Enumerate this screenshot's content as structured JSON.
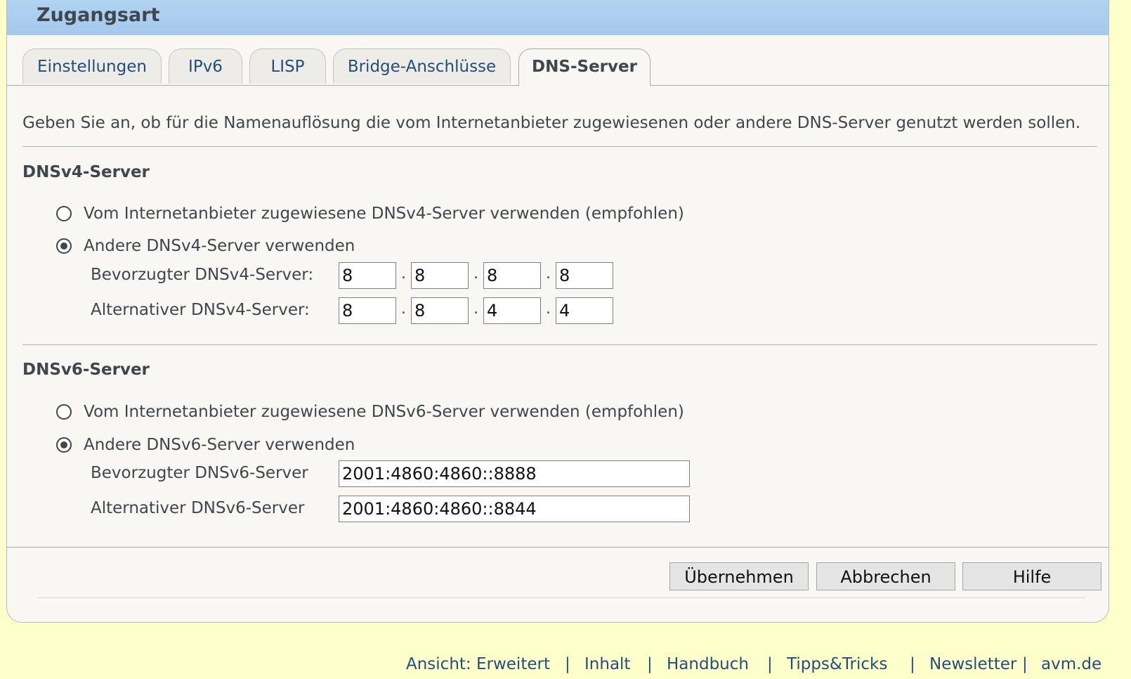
{
  "window": {
    "title": "Zugangsart"
  },
  "tabs": [
    {
      "label": "Einstellungen",
      "active": false
    },
    {
      "label": "IPv6",
      "active": false
    },
    {
      "label": "LISP",
      "active": false
    },
    {
      "label": "Bridge-Anschlüsse",
      "active": false
    },
    {
      "label": "DNS-Server",
      "active": true
    }
  ],
  "intro": "Geben Sie an, ob für die Namenauflösung die vom Internetanbieter zugewiesenen oder andere DNS-Server genutzt werden sollen.",
  "dnsv4": {
    "title": "DNSv4-Server",
    "option_provider": "Vom Internetanbieter zugewiesene DNSv4-Server verwenden (empfohlen)",
    "option_other": "Andere DNSv4-Server verwenden",
    "selected": "other",
    "preferred_label": "Bevorzugter DNSv4-Server:",
    "preferred": [
      "8",
      "8",
      "8",
      "8"
    ],
    "alternate_label": "Alternativer DNSv4-Server:",
    "alternate": [
      "8",
      "8",
      "4",
      "4"
    ],
    "separator": "."
  },
  "dnsv6": {
    "title": "DNSv6-Server",
    "option_provider": "Vom Internetanbieter zugewiesene DNSv6-Server verwenden (empfohlen)",
    "option_other": "Andere DNSv6-Server verwenden",
    "selected": "other",
    "preferred_label": "Bevorzugter DNSv6-Server",
    "preferred": "2001:4860:4860::8888",
    "alternate_label": "Alternativer DNSv6-Server",
    "alternate": "2001:4860:4860::8844"
  },
  "buttons": {
    "apply": "Übernehmen",
    "cancel": "Abbrechen",
    "help": "Hilfe"
  },
  "footer": {
    "view": "Ansicht: Erweitert",
    "contents": "Inhalt",
    "manual": "Handbuch",
    "tips": "Tipps&Tricks",
    "newsletter": "Newsletter",
    "site": "avm.de",
    "separator": "|"
  }
}
